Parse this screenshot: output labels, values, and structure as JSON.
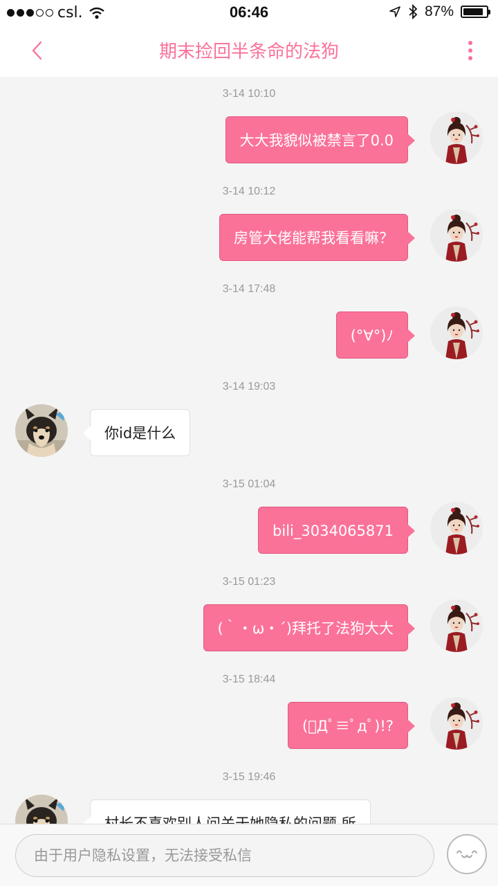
{
  "status_bar": {
    "carrier": "csl.",
    "time": "06:46",
    "battery": "87%",
    "battery_level": 0.87
  },
  "nav": {
    "title": "期末捡回半条命的法狗"
  },
  "messages": [
    {
      "time": "3-14 10:10",
      "side": "out",
      "text": "大大我貌似被禁言了0.0"
    },
    {
      "time": "3-14 10:12",
      "side": "out",
      "text": "房管大佬能帮我看看嘛？"
    },
    {
      "time": "3-14 17:48",
      "side": "out",
      "text": "(°∀°)ﾉ"
    },
    {
      "time": "3-14 19:03",
      "side": "in",
      "text": "你id是什么"
    },
    {
      "time": "3-15 01:04",
      "side": "out",
      "text": "bili_3034065871"
    },
    {
      "time": "3-15 01:23",
      "side": "out",
      "text": "(｀・ω・´)拜托了法狗大大"
    },
    {
      "time": "3-15 18:44",
      "side": "out",
      "text": "(ﾟДﾟ≡ﾟдﾟ)!?"
    },
    {
      "time": "3-15 19:46",
      "side": "in",
      "text": "村长不喜欢别人问关于她隐私的问题 所"
    }
  ],
  "input": {
    "placeholder": "由于用户隐私设置，无法接受私信"
  },
  "colors": {
    "accent": "#fb7299",
    "bubble_in": "#ffffff",
    "background": "#f4f4f4"
  },
  "icons": [
    "back-chevron-icon",
    "more-vertical-icon",
    "emoji-face-icon",
    "wifi-icon",
    "location-arrow-icon",
    "bluetooth-icon",
    "battery-icon"
  ]
}
